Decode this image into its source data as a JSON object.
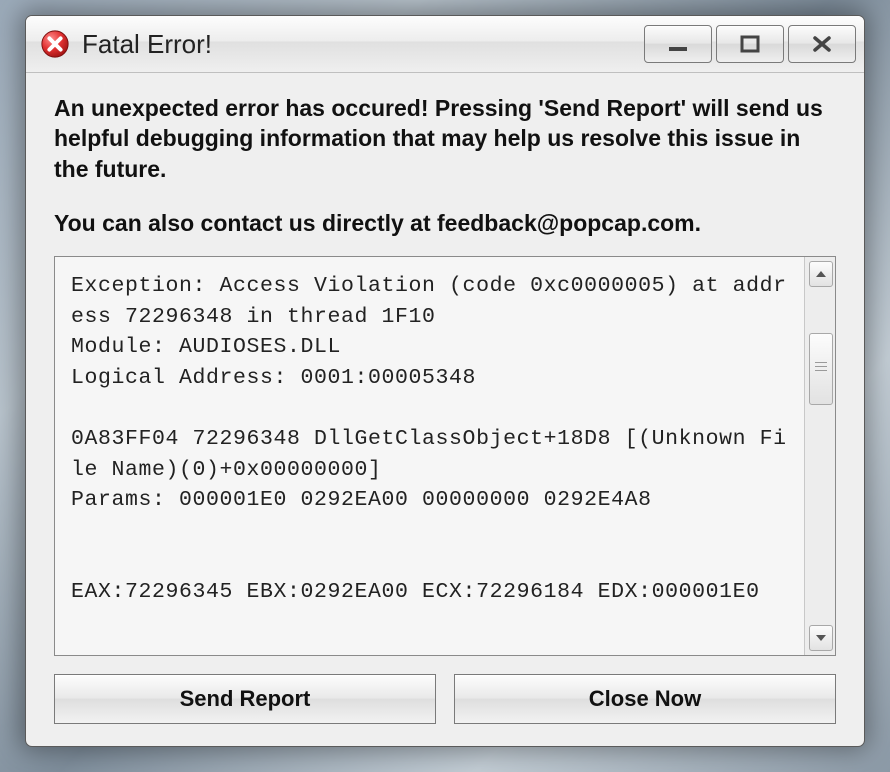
{
  "window": {
    "title": "Fatal Error!"
  },
  "message": {
    "line1": "An unexpected error has occured!  Pressing 'Send Report' will send us helpful debugging information that may help us resolve this issue in the future.",
    "line2": "You can also contact us directly at feedback@popcap.com."
  },
  "details_text": "Exception: Access Violation (code 0xc0000005) at address 72296348 in thread 1F10\nModule: AUDIOSES.DLL\nLogical Address: 0001:00005348\n\n0A83FF04 72296348 DllGetClassObject+18D8 [(Unknown File Name)(0)+0x00000000]\nParams: 000001E0 0292EA00 00000000 0292E4A8\n\n\nEAX:72296345 EBX:0292EA00 ECX:72296184 EDX:000001E0",
  "buttons": {
    "send": "Send Report",
    "close": "Close Now"
  }
}
